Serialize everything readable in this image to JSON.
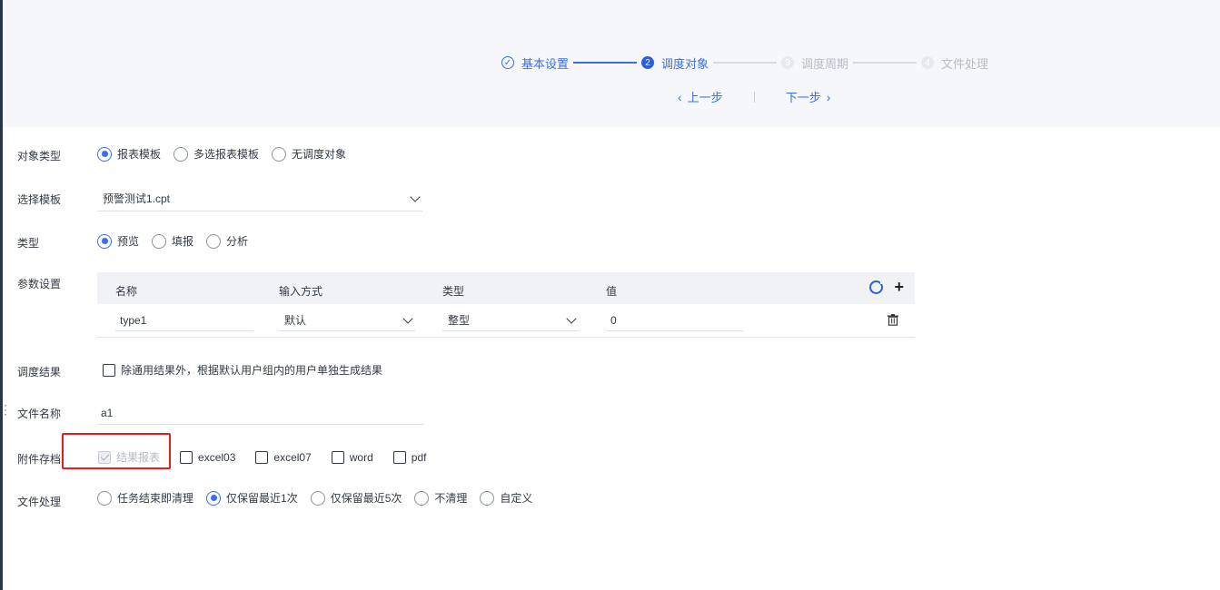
{
  "steps": [
    {
      "label": "基本设置",
      "mark": "✓",
      "state": "done"
    },
    {
      "label": "调度对象",
      "mark": "2",
      "state": "active"
    },
    {
      "label": "调度周期",
      "mark": "3",
      "state": "todo"
    },
    {
      "label": "文件处理",
      "mark": "4",
      "state": "todo"
    }
  ],
  "nav": {
    "prev_label": "上一步",
    "next_label": "下一步"
  },
  "object_type": {
    "label": "对象类型",
    "options": [
      "报表模板",
      "多选报表模板",
      "无调度对象"
    ],
    "selected": "报表模板"
  },
  "template_select": {
    "label": "选择模板",
    "value": "预警测试1.cpt"
  },
  "type": {
    "label": "类型",
    "options": [
      "预览",
      "填报",
      "分析"
    ],
    "selected": "预览"
  },
  "params": {
    "label": "参数设置",
    "headers": [
      "名称",
      "输入方式",
      "类型",
      "值"
    ],
    "rows": [
      {
        "name": "type1",
        "input_mode": "默认",
        "type": "整型",
        "value": "0"
      }
    ]
  },
  "schedule_result": {
    "label": "调度结果",
    "checkbox_label": "除通用结果外，根据默认用户组内的用户单独生成结果",
    "checked": false
  },
  "file_name": {
    "label": "文件名称",
    "value": "a1"
  },
  "attachments": {
    "label": "附件存档",
    "options": [
      {
        "label": "结果报表",
        "checked": true,
        "disabled": true
      },
      {
        "label": "excel03",
        "checked": false
      },
      {
        "label": "excel07",
        "checked": false
      },
      {
        "label": "word",
        "checked": false
      },
      {
        "label": "pdf",
        "checked": false
      }
    ]
  },
  "file_processing": {
    "label": "文件处理",
    "options": [
      "任务结束即清理",
      "仅保留最近1次",
      "仅保留最近5次",
      "不清理",
      "自定义"
    ],
    "selected": "仅保留最近1次"
  },
  "colors": {
    "accent": "#3a6fe0",
    "highlight": "#e02020"
  }
}
